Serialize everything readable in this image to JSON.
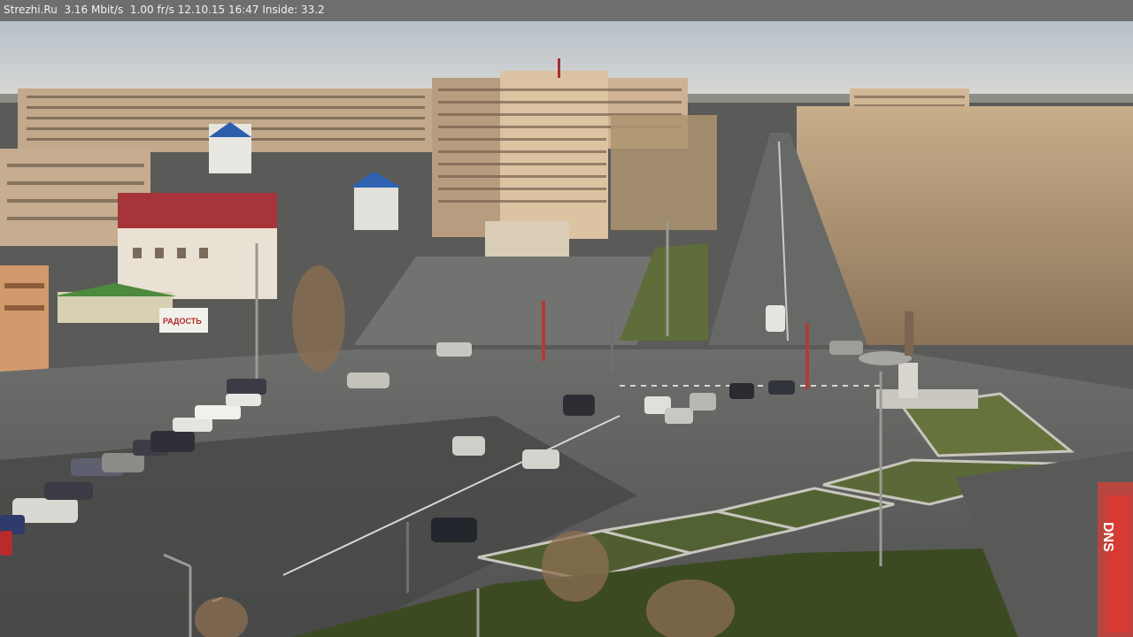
{
  "osd": {
    "text": "Strezhi.Ru  3.16 Mbit/s  1.00 fr/s 12.10.15 16:47 Inside: 33.2"
  },
  "signs": {
    "store": "DNS",
    "kiosk": "РАДОСТЬ"
  },
  "colors": {
    "sky_top": "#b9c3cc",
    "sky_bottom": "#d7d9d8",
    "road": "#5d5f5e",
    "building_beige": "#c4a98a",
    "roof_red": "#a8343a",
    "tree_bare": "#a88d6a",
    "grass": "#5b6a3a"
  }
}
